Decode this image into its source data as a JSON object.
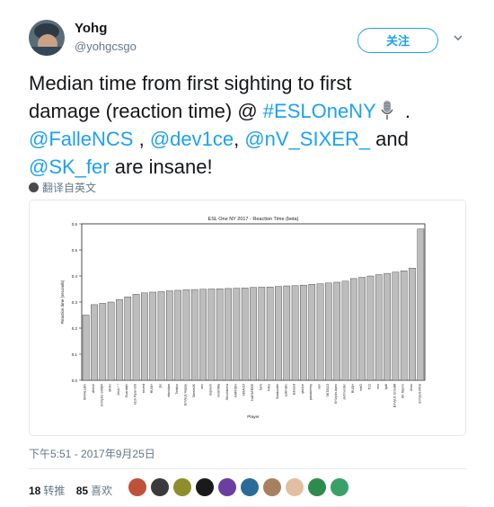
{
  "user": {
    "display_name": "Yohg",
    "handle": "@yohgcsgo",
    "follow_label": "关注"
  },
  "tweet": {
    "line1": "Median time from first sighting to first",
    "line2_text": "damage (reaction time) @ ",
    "line2_link": "#ESLOneNY",
    "line2_end": " .",
    "mention1": "@FalleNCS",
    "sep1": " , ",
    "mention2": "@dev1ce",
    "sep2": ", ",
    "mention3": "@nV_SIXER_",
    "sep3": "  and",
    "mention4": "@SK_fer",
    "end": " are insane!",
    "emoji_icon": "microphone-icon"
  },
  "translate_label": "翻译自英文",
  "timestamp": "下午5:51 - 2017年9月25日",
  "stats": {
    "retweets_count": "18",
    "retweets_label": "转推",
    "likes_count": "85",
    "likes_label": "喜欢"
  },
  "liker_avatar_colors": [
    "#c0503a",
    "#3b3b3b",
    "#8e8e2e",
    "#1a1a1a",
    "#6a3fa0",
    "#2b6b9a",
    "#a88060",
    "#e0c0a0",
    "#2e8b4e",
    "#3aa06a"
  ],
  "chart_data": {
    "type": "bar",
    "title": "ESL One NY 2017 - Reaction Time (beta)",
    "xlabel": "Player",
    "ylabel": "Reaction time (seconds)",
    "ylim": [
      0,
      0.6
    ],
    "yticks": [
      "0.0",
      "0.1",
      "0.2",
      "0.3",
      "0.4",
      "0.5",
      "0.6"
    ],
    "bar_color": "#bdbdbd",
    "categories": [
      "SKFALLEN",
      "device",
      "EnVyUs SIXER",
      "SKfer",
      "Zeus * *",
      "GuardiaN",
      "k1ck Ryan-OS",
      "seized",
      "RUSH",
      "jks",
      "stanislaw",
      "Twistzz",
      "EnVyUs Happy",
      "Stewie2K",
      "rain",
      "dupreeh",
      "kioShiMa",
      "SKcoldzera",
      "NAFNDN",
      "SKtACO",
      "NAFAFEEE",
      "tarik",
      "NiKo",
      "Skadoodle",
      "autimatic",
      "Edward",
      "gla1ve",
      "pasiakfresy",
      "rain",
      "SKTACO",
      "EnVyUs Apex",
      "olofmeister",
      "RUSH",
      "ndrD",
      "Tiz2",
      "nex",
      "fyall",
      "EnVyUs ScreaM",
      "SK flayms",
      "bnus",
      "EnVyUs RNS"
    ],
    "values": [
      0.25,
      0.29,
      0.295,
      0.3,
      0.31,
      0.32,
      0.33,
      0.335,
      0.338,
      0.34,
      0.343,
      0.345,
      0.347,
      0.348,
      0.349,
      0.35,
      0.351,
      0.352,
      0.353,
      0.354,
      0.356,
      0.357,
      0.358,
      0.36,
      0.362,
      0.363,
      0.365,
      0.368,
      0.37,
      0.373,
      0.376,
      0.38,
      0.39,
      0.395,
      0.4,
      0.405,
      0.41,
      0.415,
      0.42,
      0.43,
      0.58
    ]
  }
}
